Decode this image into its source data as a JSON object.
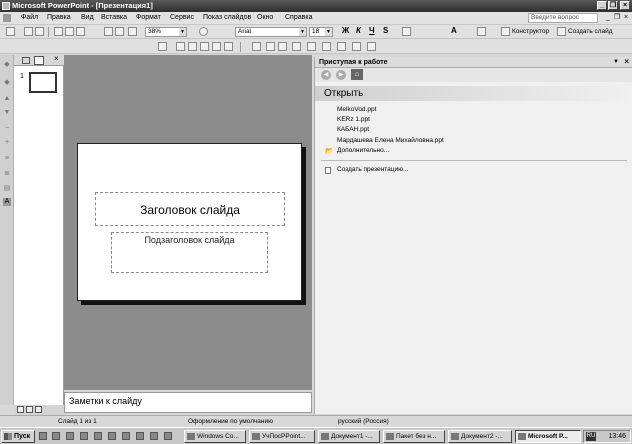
{
  "window": {
    "title": "Microsoft PowerPoint - [Презентация1]",
    "minimize_glyph": "_",
    "restore_glyph": "❐",
    "close_glyph": "×"
  },
  "menu": {
    "items": [
      "Файл",
      "Правка",
      "Вид",
      "Вставка",
      "Формат",
      "Сервис",
      "Показ слайдов",
      "Окно",
      "Справка"
    ],
    "help_search_placeholder": "Введите вопрос"
  },
  "toolbar": {
    "zoom": "38%",
    "font": "Arial",
    "font_size": "18",
    "bold": "Ж",
    "italic": "К",
    "underline": "Ч",
    "shadow": "S",
    "grow_font": "A",
    "designer_label": "Конструктор",
    "new_slide_label": "Создать слайд"
  },
  "thumbnails": {
    "slide_number": "1"
  },
  "slide": {
    "title_placeholder": "Заголовок слайда",
    "subtitle_placeholder": "Подзаголовок слайда"
  },
  "notes": {
    "placeholder": "Заметки к слайду"
  },
  "taskpane": {
    "title": "Приступая к работе",
    "open_section": "Открыть",
    "recent_files": [
      "MelkoVod.ppt",
      "KERz 1.ppt",
      "КАБАН.ppt",
      "Мардашева Елена Михайловна.ppt"
    ],
    "more_link": "Дополнительно...",
    "create_link": "Создать презентацию..."
  },
  "statusbar": {
    "slide_info": "Слайд 1 из 1",
    "design": "Оформление по умолчанию",
    "language": "русский (Россия)"
  },
  "taskbar": {
    "start": "Пуск",
    "tasks": [
      "Windows Co...",
      "УчПосPPoint...",
      "Документ1 -...",
      "Пакет без н...",
      "Документ2 -...",
      "Microsoft P..."
    ],
    "language_indicator": "RU",
    "clock": "13:46"
  },
  "colors": {
    "titlebar": "#3a3a3a",
    "slide_area": "#8c8c8c",
    "taskpane": "#f0f0f0"
  }
}
